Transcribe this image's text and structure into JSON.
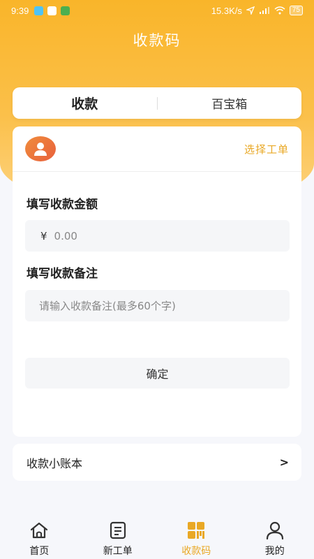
{
  "status_bar": {
    "time": "9:39",
    "network_speed": "15.3K/s",
    "battery": "75"
  },
  "header": {
    "title": "收款码"
  },
  "tabs": [
    {
      "label": "收款",
      "active": true
    },
    {
      "label": "百宝箱",
      "active": false
    }
  ],
  "card": {
    "select_order": "选择工单",
    "amount_label": "填写收款金额",
    "amount_currency": "¥",
    "amount_placeholder": "0.00",
    "note_label": "填写收款备注",
    "note_placeholder": "请输入收款备注(最多60个字)",
    "confirm_label": "确定"
  },
  "ledger": {
    "label": "收款小账本",
    "chevron": ">"
  },
  "bottom_nav": [
    {
      "label": "首页",
      "icon": "home-icon",
      "active": false
    },
    {
      "label": "新工单",
      "icon": "document-icon",
      "active": false
    },
    {
      "label": "收款码",
      "icon": "qr-code-icon",
      "active": true
    },
    {
      "label": "我的",
      "icon": "user-icon",
      "active": false
    }
  ],
  "colors": {
    "accent": "#f9b52a",
    "link": "#e9a825",
    "background": "#f6f7fb"
  }
}
